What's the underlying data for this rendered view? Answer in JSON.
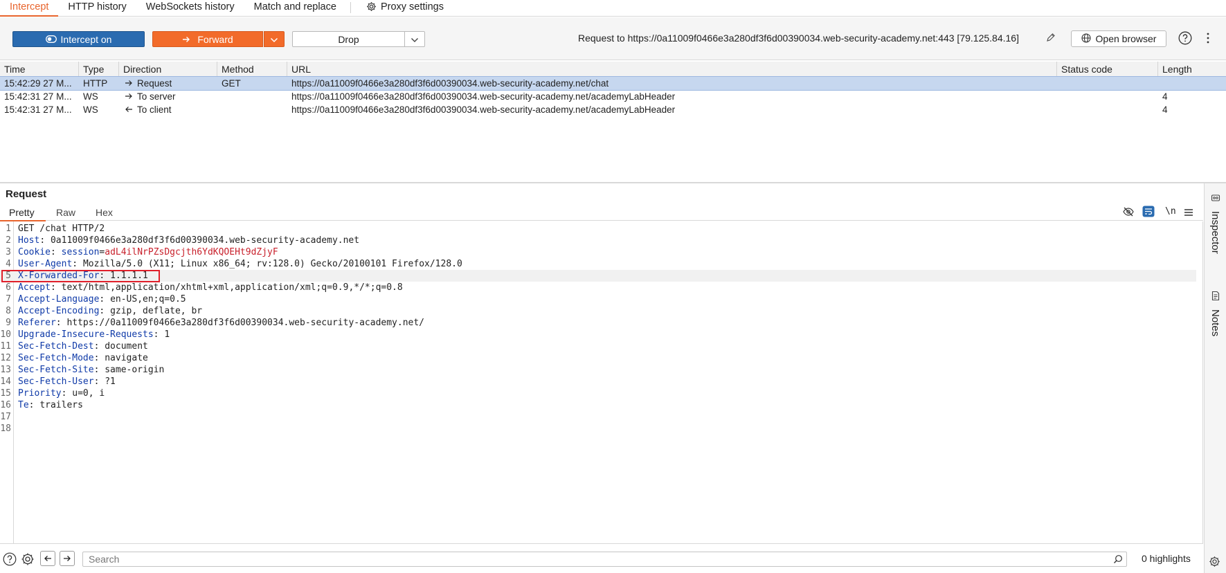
{
  "tabs": [
    {
      "label": "Intercept",
      "active": true
    },
    {
      "label": "HTTP history"
    },
    {
      "label": "WebSockets history"
    },
    {
      "label": "Match and replace"
    },
    {
      "label": "Proxy settings"
    }
  ],
  "toolbar": {
    "intercept_label": "Intercept on",
    "forward_label": "Forward",
    "drop_label": "Drop",
    "request_to": "Request to https://0a11009f0466e3a280df3f6d00390034.web-security-academy.net:443  [79.125.84.16]",
    "open_browser_label": "Open browser"
  },
  "colors": {
    "accent": "#f26b2a",
    "intercept": "#2a6bb0",
    "selected_row": "#c6d7ef",
    "highlight_box": "#e01f2a"
  },
  "table": {
    "columns": [
      "Time",
      "Type",
      "Direction",
      "Method",
      "URL",
      "Status code",
      "Length"
    ],
    "rows": [
      {
        "time": "15:42:29 27 M...",
        "type": "HTTP",
        "direction_icon": "arrow-right-icon",
        "direction": "Request",
        "method": "GET",
        "url": "https://0a11009f0466e3a280df3f6d00390034.web-security-academy.net/chat",
        "status": "",
        "length": ""
      },
      {
        "time": "15:42:31 27 M...",
        "type": "WS",
        "direction_icon": "arrow-right-icon",
        "direction": "To server",
        "method": "",
        "url": "https://0a11009f0466e3a280df3f6d00390034.web-security-academy.net/academyLabHeader",
        "status": "",
        "length": "4"
      },
      {
        "time": "15:42:31 27 M...",
        "type": "WS",
        "direction_icon": "arrow-left-icon",
        "direction": "To client",
        "method": "",
        "url": "https://0a11009f0466e3a280df3f6d00390034.web-security-academy.net/academyLabHeader",
        "status": "",
        "length": "4"
      }
    ]
  },
  "request": {
    "title": "Request",
    "tabs": [
      "Pretty",
      "Raw",
      "Hex"
    ],
    "lines": [
      {
        "n": "1",
        "text": "GET /chat HTTP/2"
      },
      {
        "n": "2",
        "key": "Host",
        "value": "0a11009f0466e3a280df3f6d00390034.web-security-academy.net"
      },
      {
        "n": "3",
        "key": "Cookie",
        "cookie_name": "session",
        "cookie_value": "adL4ilNrPZsDgcjth6YdKQOEHt9dZjyF"
      },
      {
        "n": "4",
        "key": "User-Agent",
        "value": "Mozilla/5.0 (X11; Linux x86_64; rv:128.0) Gecko/20100101 Firefox/128.0"
      },
      {
        "n": "5",
        "key": "X-Forwarded-For",
        "value": "1.1.1.1"
      },
      {
        "n": "6",
        "key": "Accept",
        "value": "text/html,application/xhtml+xml,application/xml;q=0.9,*/*;q=0.8"
      },
      {
        "n": "7",
        "key": "Accept-Language",
        "value": "en-US,en;q=0.5"
      },
      {
        "n": "8",
        "key": "Accept-Encoding",
        "value": "gzip, deflate, br"
      },
      {
        "n": "9",
        "key": "Referer",
        "value": "https://0a11009f0466e3a280df3f6d00390034.web-security-academy.net/"
      },
      {
        "n": "10",
        "key": "Upgrade-Insecure-Requests",
        "value": "1"
      },
      {
        "n": "11",
        "key": "Sec-Fetch-Dest",
        "value": "document"
      },
      {
        "n": "12",
        "key": "Sec-Fetch-Mode",
        "value": "navigate"
      },
      {
        "n": "13",
        "key": "Sec-Fetch-Site",
        "value": "same-origin"
      },
      {
        "n": "14",
        "key": "Sec-Fetch-User",
        "value": "?1"
      },
      {
        "n": "15",
        "key": "Priority",
        "value": "u=0, i"
      },
      {
        "n": "16",
        "key": "Te",
        "value": "trailers"
      },
      {
        "n": "17",
        "text": ""
      },
      {
        "n": "18",
        "text": ""
      }
    ],
    "newline_toggle": "\\n"
  },
  "sidebar": {
    "inspector_label": "Inspector",
    "notes_label": "Notes"
  },
  "bottom": {
    "search_placeholder": "Search",
    "highlights": "0 highlights"
  }
}
